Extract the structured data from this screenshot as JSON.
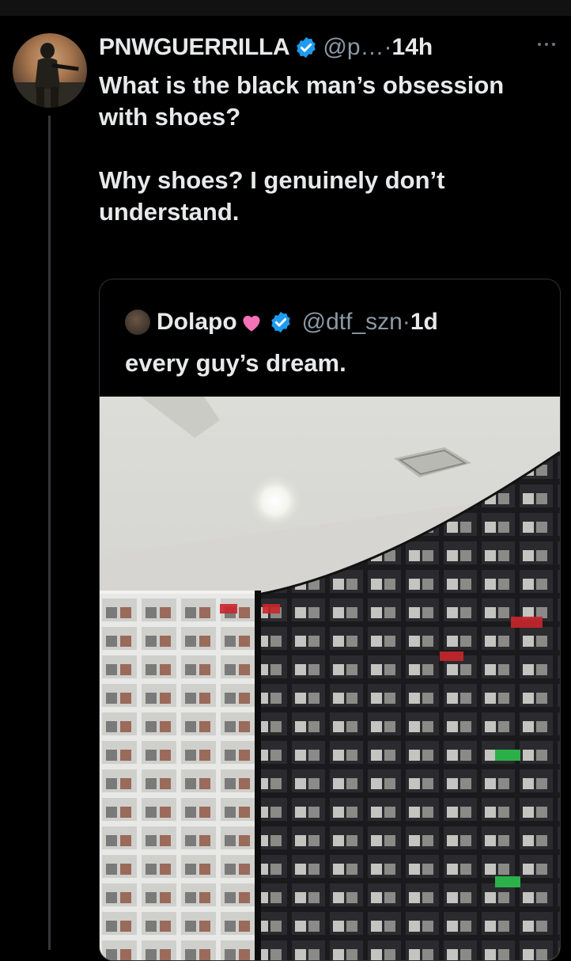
{
  "tweet": {
    "display_name": "PNWGUERRILLA",
    "handle": "@p…",
    "separator": "·",
    "time": "14h",
    "paragraphs": [
      "What is the black man’s obsession with shoes?",
      "Why shoes? I genuinely don’t understand."
    ]
  },
  "quote": {
    "display_name": "Dolapo",
    "handle": "@dtf_szn",
    "separator": "·",
    "time": "1d",
    "text": "every guy’s dream."
  },
  "icons": {
    "verified": "verified-badge-icon",
    "more": "more-options-icon",
    "heart": "pink-heart-emoji"
  },
  "colors": {
    "background": "#000000",
    "text": "#e7e9ea",
    "secondary": "#8b98a5",
    "verified": "#1d9bf0",
    "heart": "#f472b6"
  }
}
